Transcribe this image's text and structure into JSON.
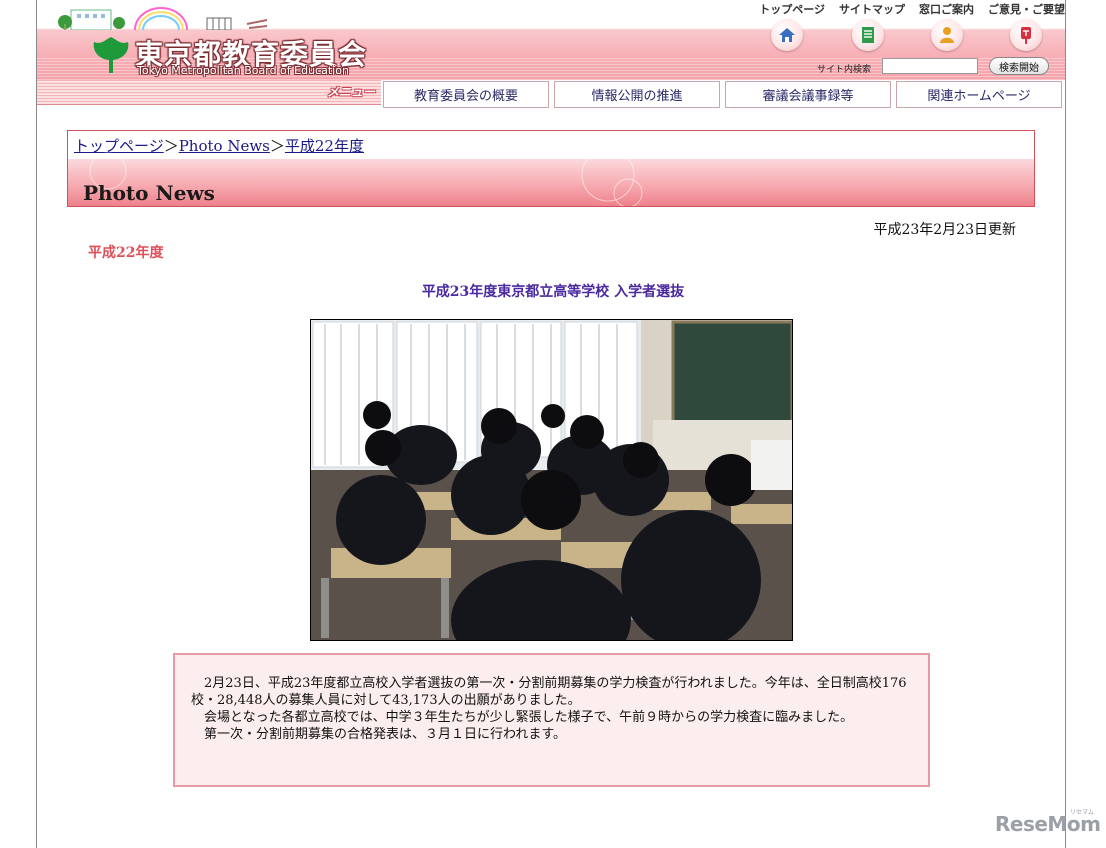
{
  "header": {
    "logo_title": "東京都教育委員会",
    "logo_subtitle": "Tokyo Metropolitan Board of Education",
    "util_links": [
      "トップページ",
      "サイトマップ",
      "窓口ご案内",
      "ご意見・ご要望"
    ],
    "icons": [
      "home-icon",
      "sitemap-icon",
      "person-icon",
      "postbox-icon"
    ],
    "search_label": "サイト内検索",
    "search_value": "",
    "search_button": "検索開始",
    "accent_color": "#f4a3a9"
  },
  "nav": {
    "menu_label": "メニュー",
    "tabs": [
      "教育委員会の概要",
      "情報公開の推進",
      "審議会議事録等",
      "関連ホームページ"
    ]
  },
  "breadcrumb": {
    "items": [
      "トップページ",
      "Photo News",
      "平成22年度"
    ],
    "separator": "＞"
  },
  "page": {
    "title": "Photo News",
    "updated": "平成23年2月23日更新",
    "year_heading": "平成22年度",
    "article_title": "平成23年度東京都立高等学校 入学者選抜",
    "paragraphs": [
      "2月23日、平成23年度都立高校入学者選抜の第一次・分割前期募集の学力検査が行われました。今年は、全日制高校176校・28,448人の募集人員に対して43,173人の出願がありました。",
      "会場となった各都立高校では、中学３年生たちが少し緊張した様子で、午前９時からの学力検査に臨みました。",
      "第一次・分割前期募集の合格発表は、３月１日に行われます。"
    ]
  },
  "watermark": {
    "text": "ReseMom",
    "small": "リセマム"
  }
}
